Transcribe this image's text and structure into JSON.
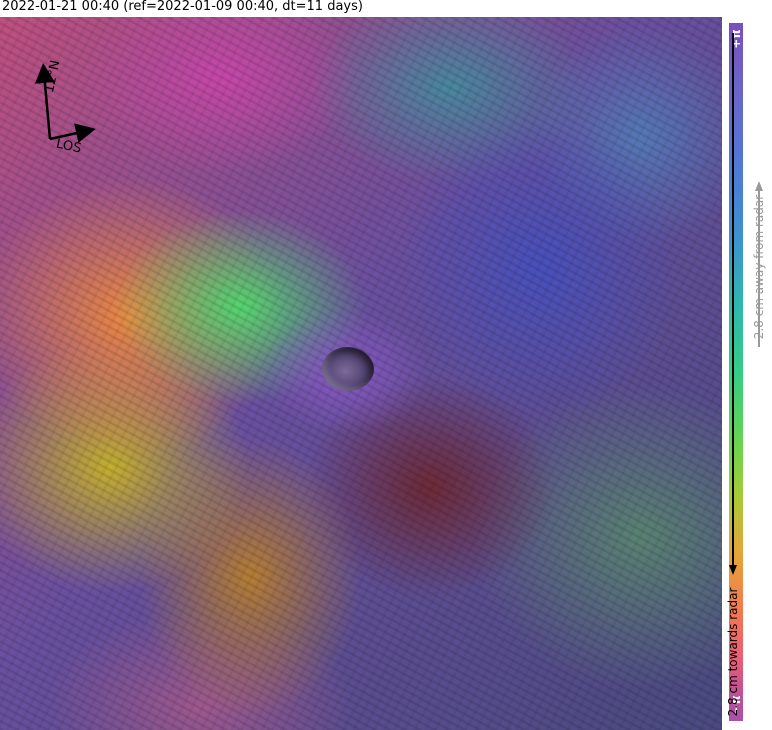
{
  "title": "2022-01-21 00:40 (ref=2022-01-09 00:40, dt=11 days)",
  "compass": {
    "north_label": "12°N",
    "los_label": "LOS"
  },
  "colorbar": {
    "top_label": "+π",
    "bottom_label": "−π",
    "away_label": "2.8 cm away from radar",
    "towards_label": "2.8 cm towards radar",
    "colors": [
      "#7a4fbf",
      "#5178d4",
      "#2fb6b0",
      "#35cc86",
      "#a9c936",
      "#f27a4f",
      "#c25194"
    ]
  }
}
